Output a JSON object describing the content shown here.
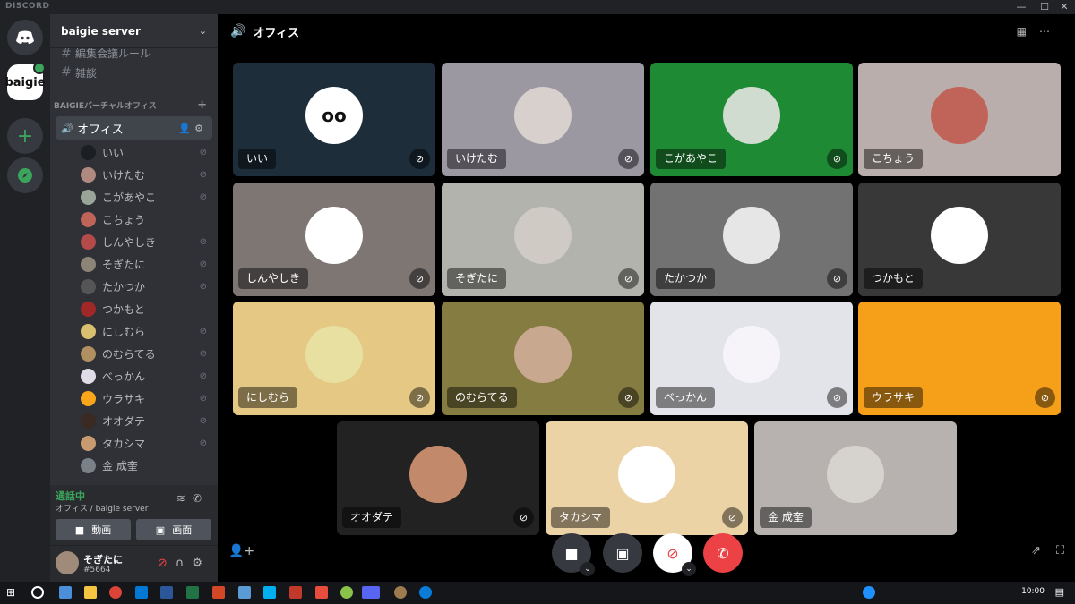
{
  "app": {
    "brand": "DISCORD"
  },
  "window": {
    "minimize": "—",
    "maximize": "☐",
    "close": "✕"
  },
  "guilds": {
    "baigie_label": "baigie"
  },
  "server": {
    "name": "baigie server"
  },
  "channels": {
    "text_partial": "編集会議ルール",
    "text": "雑談",
    "category": "BAIGIEバーチャルオフィス",
    "voice_channel": "オフィス"
  },
  "voice_users": [
    {
      "name": "いい",
      "muted": true,
      "color": "#1b1e22"
    },
    {
      "name": "いけたむ",
      "muted": true,
      "color": "#b08a80"
    },
    {
      "name": "こがあやこ",
      "muted": true,
      "color": "#9aa59a"
    },
    {
      "name": "こちょう",
      "muted": false,
      "color": "#c0645a"
    },
    {
      "name": "しんやしき",
      "muted": true,
      "color": "#b44a4a"
    },
    {
      "name": "そぎたに",
      "muted": true,
      "color": "#8d8478"
    },
    {
      "name": "たかつか",
      "muted": true,
      "color": "#555555"
    },
    {
      "name": "つかもと",
      "muted": false,
      "color": "#a02828"
    },
    {
      "name": "にしむら",
      "muted": true,
      "color": "#d8c070"
    },
    {
      "name": "のむらてる",
      "muted": true,
      "color": "#b09060"
    },
    {
      "name": "べっかん",
      "muted": true,
      "color": "#e0dce8"
    },
    {
      "name": "ウラサキ",
      "muted": true,
      "color": "#faa61a"
    },
    {
      "name": "オオダテ",
      "muted": true,
      "color": "#3a2a22"
    },
    {
      "name": "タカシマ",
      "muted": true,
      "color": "#c89a70"
    },
    {
      "name": "金 成奎",
      "muted": false,
      "color": "#7a8088"
    }
  ],
  "voice_panel": {
    "status": "通話中",
    "location": "オフィス / baigie server",
    "video_label": "動画",
    "screen_label": "画面"
  },
  "user": {
    "name": "そぎたに",
    "tag": "#5664"
  },
  "main": {
    "title": "オフィス"
  },
  "tiles": [
    {
      "name": "いい",
      "muted": true,
      "bg": "#1e2d3a",
      "avatar_color": "#ffffff",
      "avatar_text": "oo"
    },
    {
      "name": "いけたむ",
      "muted": true,
      "bg": "#9b98a2",
      "avatar_color": "#d8d0cc",
      "avatar_text": ""
    },
    {
      "name": "こがあやこ",
      "muted": true,
      "bg": "#1f8a34",
      "avatar_color": "#d0dcd0",
      "avatar_text": ""
    },
    {
      "name": "こちょう",
      "muted": false,
      "bg": "#b9aeab",
      "avatar_color": "#c0645a",
      "avatar_text": ""
    },
    {
      "name": "しんやしき",
      "muted": true,
      "bg": "#7d7673",
      "avatar_color": "#ffffff",
      "avatar_text": ""
    },
    {
      "name": "そぎたに",
      "muted": true,
      "bg": "#b3b3ae",
      "avatar_color": "#cfcac3",
      "avatar_text": ""
    },
    {
      "name": "たかつか",
      "muted": true,
      "bg": "#727272",
      "avatar_color": "#e6e6e6",
      "avatar_text": ""
    },
    {
      "name": "つかもと",
      "muted": false,
      "bg": "#383838",
      "avatar_color": "#ffffff",
      "avatar_text": ""
    },
    {
      "name": "にしむら",
      "muted": true,
      "bg": "#e4c884",
      "avatar_color": "#e8e0a0",
      "avatar_text": ""
    },
    {
      "name": "のむらてる",
      "muted": true,
      "bg": "#857c42",
      "avatar_color": "#c9a890",
      "avatar_text": ""
    },
    {
      "name": "べっかん",
      "muted": true,
      "bg": "#e3e3ea",
      "avatar_color": "#f6f4f8",
      "avatar_text": ""
    },
    {
      "name": "ウラサキ",
      "muted": true,
      "bg": "#f6a01a",
      "avatar_color": "#f6a01a",
      "avatar_text": ""
    },
    {
      "name": "オオダテ",
      "muted": true,
      "bg": "#222222",
      "avatar_color": "#c28a6a",
      "avatar_text": ""
    },
    {
      "name": "タカシマ",
      "muted": true,
      "bg": "#ecd3a6",
      "avatar_color": "#ffffff",
      "avatar_text": ""
    },
    {
      "name": "金 成奎",
      "muted": false,
      "bg": "#b7b2af",
      "avatar_color": "#d6d2ce",
      "avatar_text": ""
    }
  ],
  "taskbar": {
    "clock": "10:00"
  },
  "icons": {
    "mic_muted": "🎙",
    "speaker": "🔊"
  }
}
